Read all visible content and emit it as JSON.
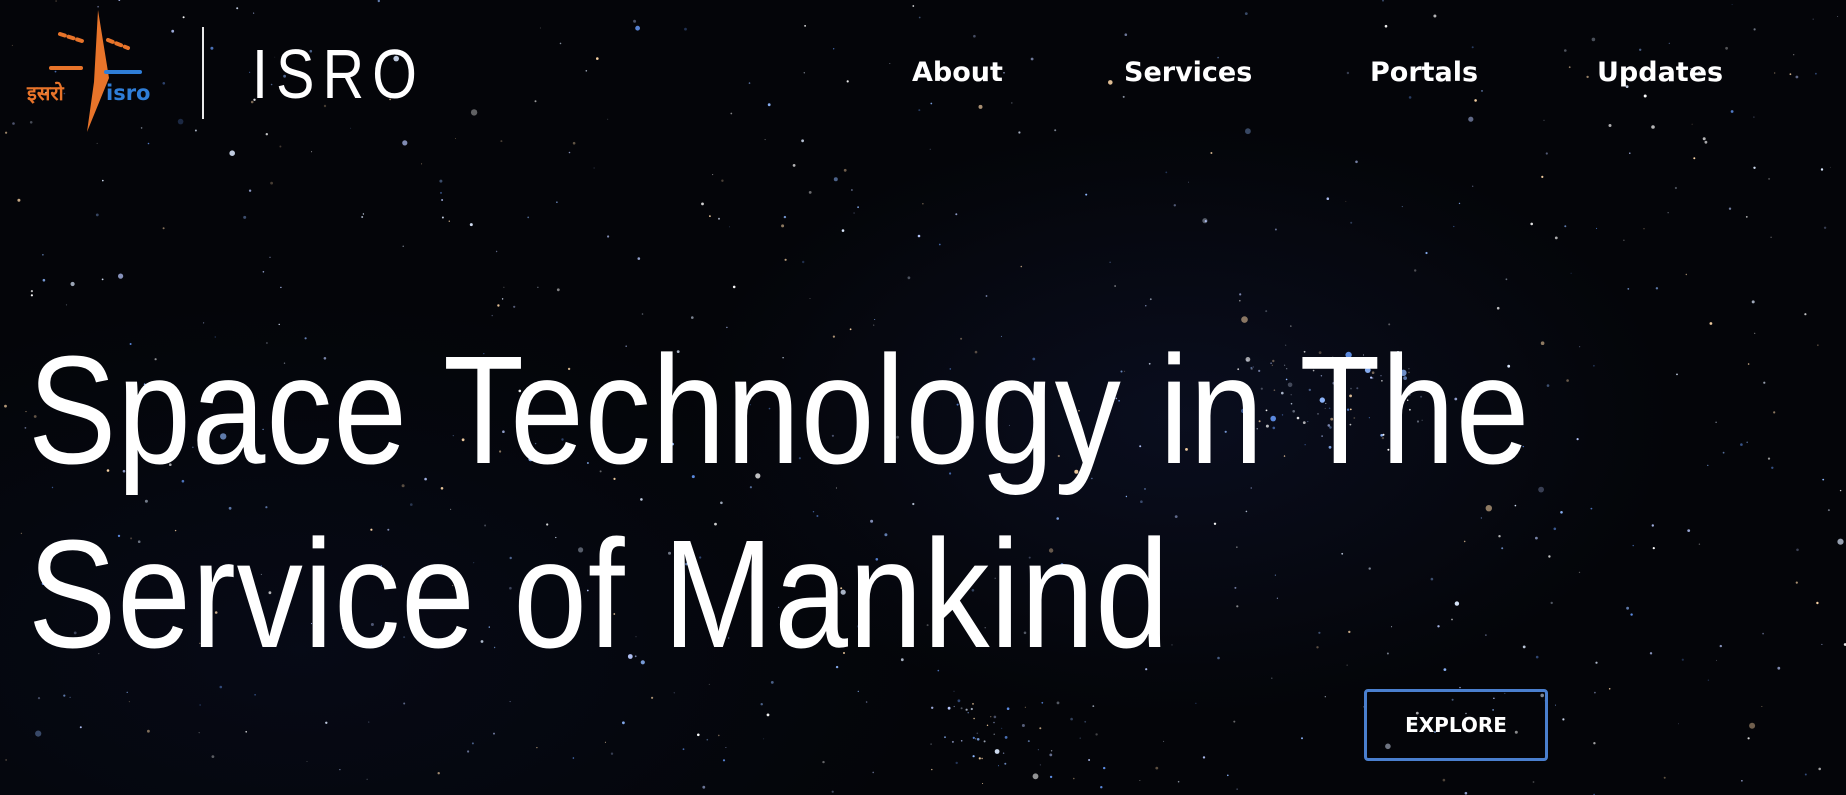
{
  "brand": {
    "logo_icon": "isro-rocket-logo-icon",
    "logo_hindi_text": "इसरो",
    "logo_latin_text": "isro",
    "title": "ISRO",
    "logo_colors": {
      "orange": "#e8742a",
      "blue": "#2f7ed8"
    }
  },
  "nav": {
    "items": [
      {
        "label": "About"
      },
      {
        "label": "Services"
      },
      {
        "label": "Portals"
      },
      {
        "label": "Updates"
      }
    ]
  },
  "hero": {
    "title_line_1": "Space Technology in The",
    "title_line_2": "Service of Mankind",
    "background": "starfield",
    "cta_label": "EXPLORE",
    "cta_border_color": "#4a7fce"
  }
}
